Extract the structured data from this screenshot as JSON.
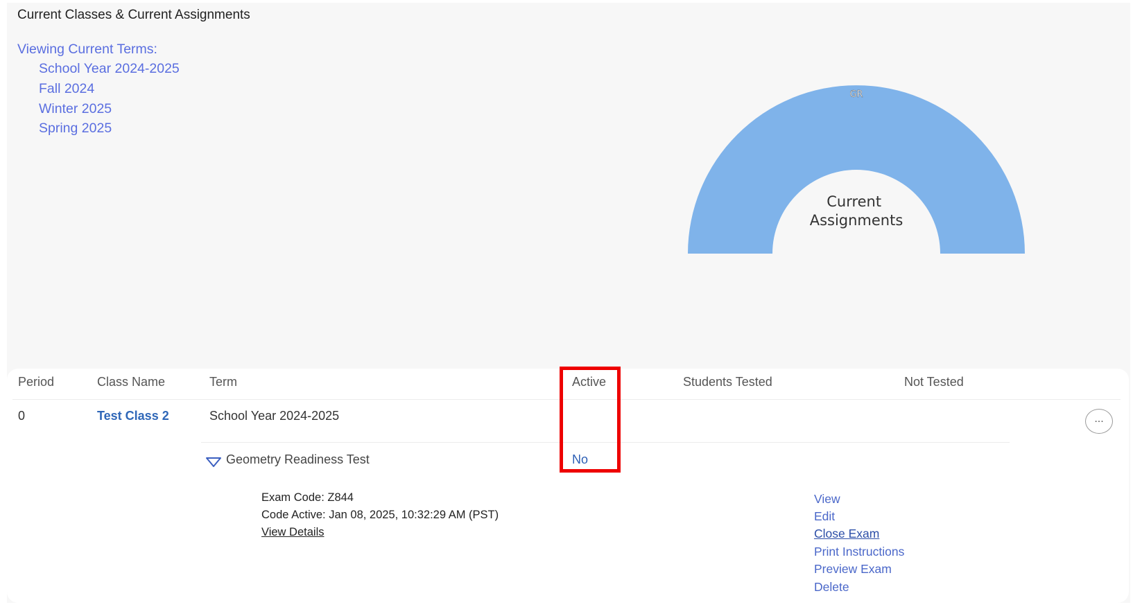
{
  "header": {
    "title": "Current Classes & Current Assignments"
  },
  "terms": {
    "label": "Viewing Current Terms:",
    "items": [
      "School Year 2024-2025",
      "Fall 2024",
      "Winter 2025",
      "Spring 2025"
    ]
  },
  "chart_data": {
    "type": "pie",
    "title": "",
    "center_label": "Current Assignments",
    "categories": [
      "GR"
    ],
    "values": [
      1
    ],
    "colors": [
      "#7fb3ea"
    ]
  },
  "table": {
    "headers": {
      "period": "Period",
      "class_name": "Class Name",
      "term": "Term",
      "active": "Active",
      "students_tested": "Students Tested",
      "not_tested": "Not Tested"
    },
    "row": {
      "period": "0",
      "class_name": "Test Class 2",
      "term": "School Year 2024-2025",
      "more_label": "..."
    },
    "assignment": {
      "name": "Geometry Readiness Test",
      "active": "No",
      "exam_code": "Exam Code: Z844",
      "code_active": "Code Active: Jan 08, 2025, 10:32:29 AM (PST)",
      "view_details": "View Details",
      "actions": [
        "View",
        "Edit",
        "Close Exam",
        "Print Instructions",
        "Preview Exam",
        "Delete"
      ]
    }
  },
  "colors": {
    "link": "#5a6ee0",
    "chart_fill": "#7fb3ea",
    "highlight": "#ee0000"
  }
}
